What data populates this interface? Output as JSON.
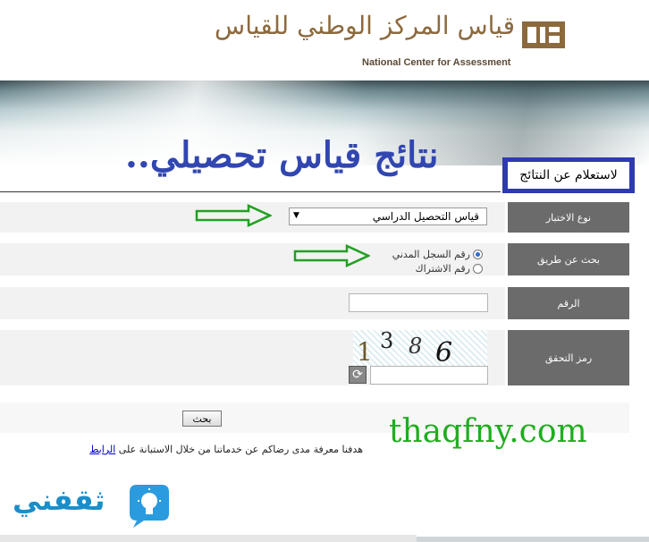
{
  "header": {
    "logo_arabic": "قياس المركز الوطني للقياس",
    "logo_english": "National Center for Assessment",
    "logo_mark_text": "قياس"
  },
  "headline": "نتائج قياس تحصيلي..",
  "inquiry_title": "لاستعلام عن النتائج",
  "form": {
    "exam_type": {
      "label": "نوع الاختبار",
      "selected": "قياس التحصيل الدراسي"
    },
    "search_by": {
      "label": "بحث عن طريق",
      "options": [
        {
          "label": "رقم السجل المدني",
          "checked": true
        },
        {
          "label": "رقم الاشتراك",
          "checked": false
        }
      ]
    },
    "number": {
      "label": "الرقم",
      "value": ""
    },
    "captcha": {
      "label": "رمز التحقق",
      "digits": [
        "1",
        "3",
        "8",
        "6"
      ],
      "input_value": ""
    },
    "search_button": "بحث"
  },
  "survey": {
    "text": "هدفنا معرفة مدى رضاكم عن خدماتنا من خلال الاستبانة على",
    "link": "الرابط"
  },
  "watermark": "thaqfny.com",
  "bottom_logo": "ثقفني",
  "colors": {
    "brand_brown": "#8c6a3e",
    "headline_blue": "#3146b0",
    "label_gray": "#6b6b6b",
    "arrow_green": "#22a022",
    "watermark_green": "#1fae1f",
    "bottom_logo_blue": "#1b8ec9"
  },
  "icons": {
    "refresh": "refresh-icon",
    "arrow": "arrow-right-icon",
    "dropdown": "caret-down-icon",
    "bulb": "lightbulb-icon"
  }
}
